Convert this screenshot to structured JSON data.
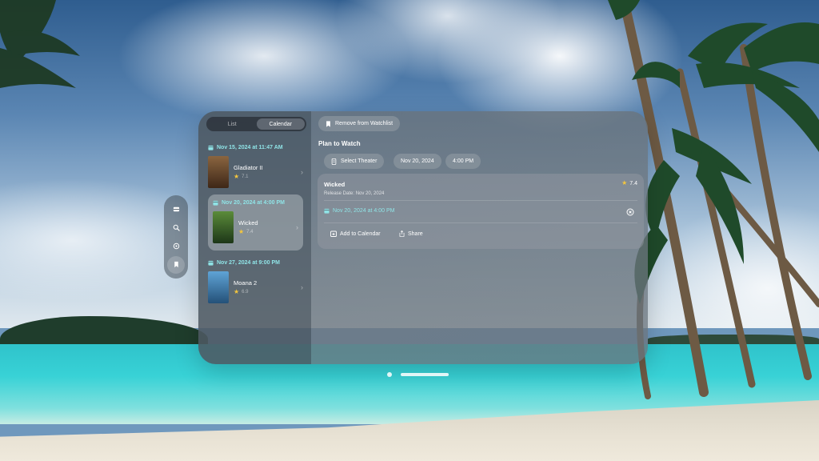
{
  "tabs": {
    "list_label": "List",
    "calendar_label": "Calendar"
  },
  "sidebar": {
    "items": [
      {
        "icon": "film-icon"
      },
      {
        "icon": "search-icon"
      },
      {
        "icon": "gear-icon"
      },
      {
        "icon": "bookmark-icon"
      }
    ]
  },
  "schedule": [
    {
      "date": "Nov 15, 2024 at 11:47 AM",
      "title": "Gladiator II",
      "rating": "7.1",
      "poster_color": "#6b4a2e"
    },
    {
      "date": "Nov 20, 2024 at 4:00 PM",
      "title": "Wicked",
      "rating": "7.4",
      "poster_color": "#3f6a2f"
    },
    {
      "date": "Nov 27, 2024 at 9:00 PM",
      "title": "Moana 2",
      "rating": "6.9",
      "poster_color": "#3b7fb0"
    }
  ],
  "toolbar": {
    "remove_label": "Remove from Watchlist"
  },
  "plan": {
    "section_title": "Plan to Watch",
    "select_theater_label": "Select Theater",
    "date_value": "Nov 20, 2024",
    "time_value": "4:00 PM"
  },
  "detail": {
    "title": "Wicked",
    "rating": "7.4",
    "release": "Release Date: Nov 20, 2024",
    "showtime": "Nov 20, 2024 at 4:00 PM",
    "add_calendar_label": "Add to Calendar",
    "share_label": "Share"
  },
  "colors": {
    "accent_teal": "#8fe3e6",
    "star_yellow": "#f4c63d"
  }
}
